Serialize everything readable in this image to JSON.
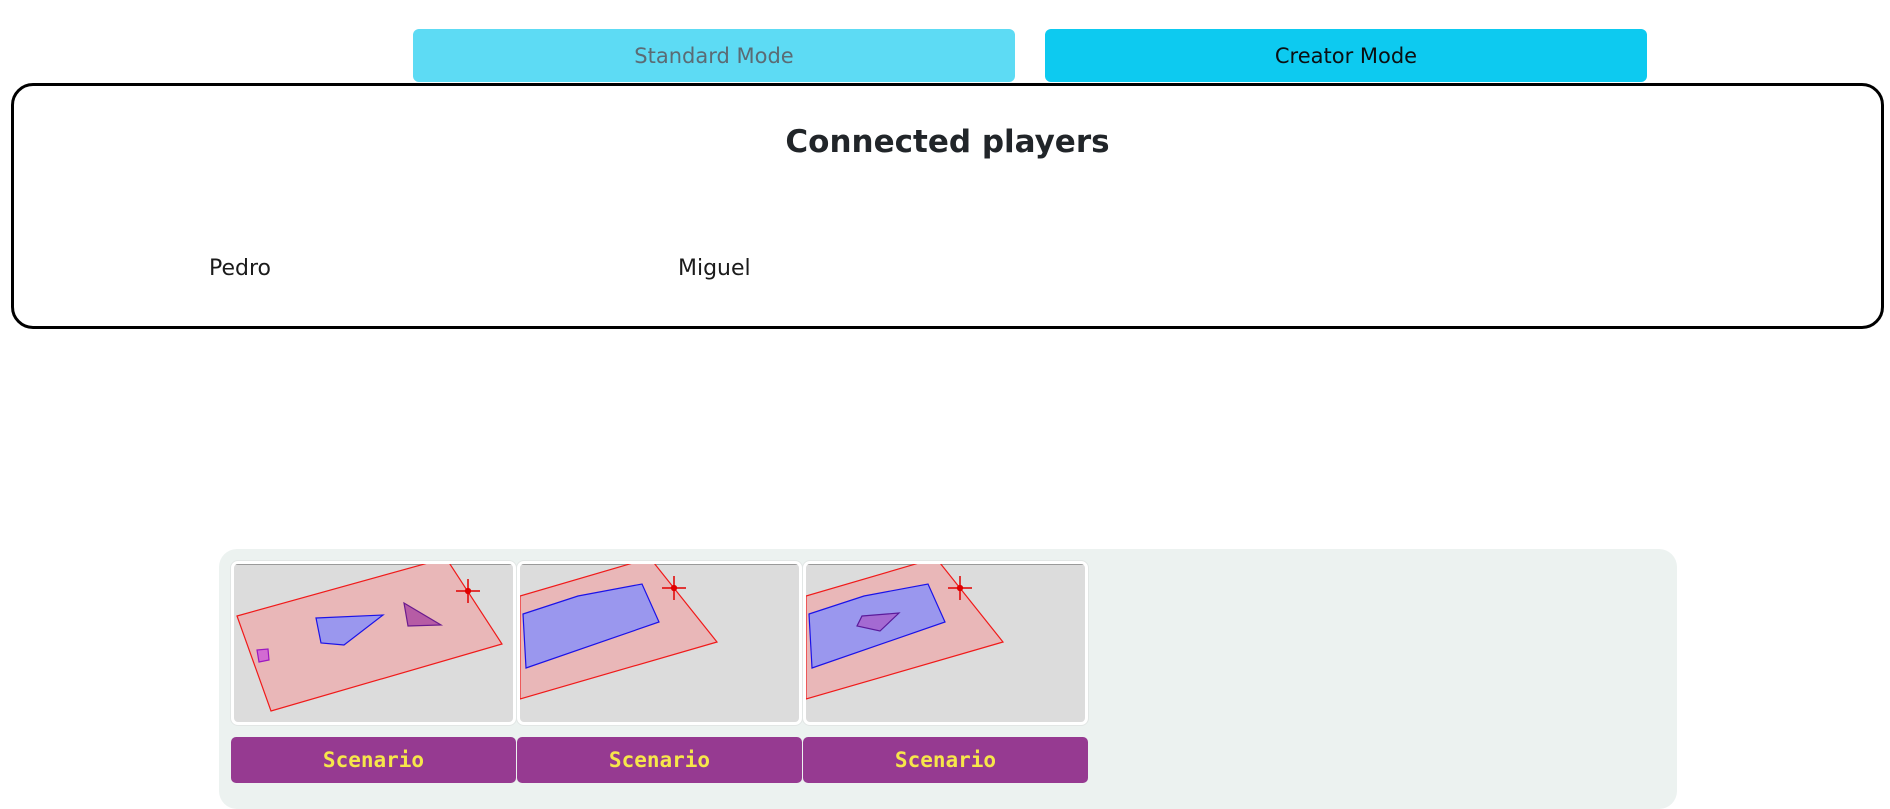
{
  "modes": {
    "standard_label": "Standard Mode",
    "creator_label": "Creator Mode"
  },
  "players_panel": {
    "title": "Connected players",
    "players": [
      "Pedro",
      "Miguel"
    ]
  },
  "scenarios": [
    {
      "button_label": "Scenario"
    },
    {
      "button_label": "Scenario"
    },
    {
      "button_label": "Scenario"
    }
  ],
  "colors": {
    "standard_button": "#5ddbf4",
    "creator_button": "#0dcaf0",
    "scenario_button": "#963a91",
    "scenario_button_text": "#f6e64a",
    "tray_background": "#ecf2f0",
    "zone_fill": "#e9b7b8",
    "zone_stroke": "#f01a1a",
    "obstacle_fill": "#9a97ee",
    "obstacle_stroke": "#1b12e8"
  }
}
